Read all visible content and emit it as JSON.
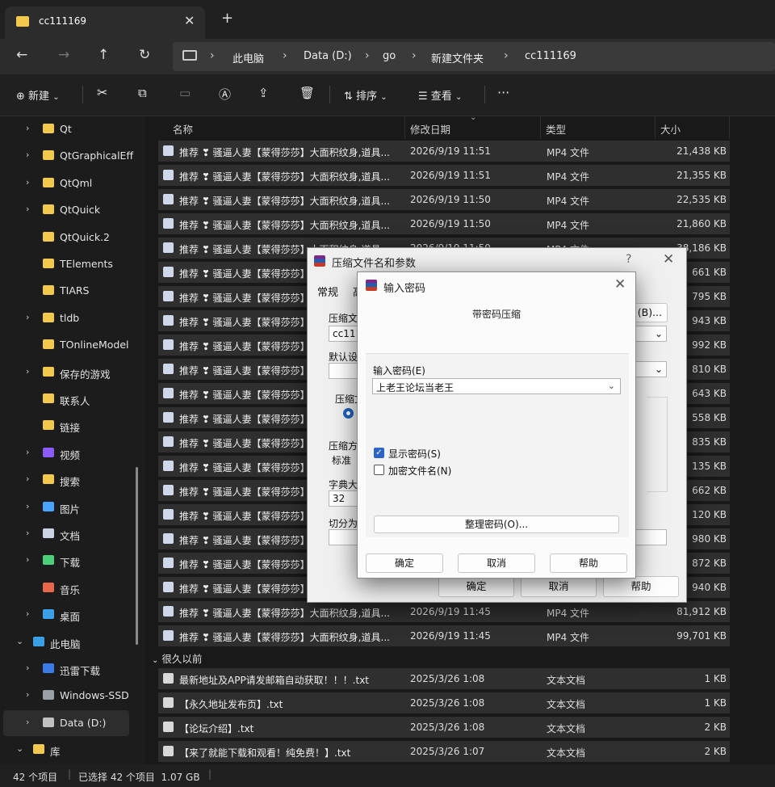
{
  "tab": {
    "title": "cc111169"
  },
  "address": {
    "crumbs": [
      "此电脑",
      "Data (D:)",
      "go",
      "新建文件夹",
      "cc111169"
    ]
  },
  "toolbar": {
    "new_label": "新建",
    "sort_label": "排序",
    "view_label": "查看",
    "more_label": "···"
  },
  "sidebar": {
    "items": [
      {
        "label": "Qt",
        "chev": true
      },
      {
        "label": "QtGraphicalEff",
        "chev": true
      },
      {
        "label": "QtQml",
        "chev": true
      },
      {
        "label": "QtQuick",
        "chev": true
      },
      {
        "label": "QtQuick.2",
        "chev": false
      },
      {
        "label": "TElements",
        "chev": false
      },
      {
        "label": "TIARS",
        "chev": false
      },
      {
        "label": "tldb",
        "chev": true
      },
      {
        "label": "TOnlineModel",
        "chev": false
      },
      {
        "label": "保存的游戏",
        "chev": true
      },
      {
        "label": "联系人",
        "chev": false
      },
      {
        "label": "链接",
        "chev": false
      },
      {
        "label": "视频",
        "chev": true
      },
      {
        "label": "搜索",
        "chev": true
      },
      {
        "label": "图片",
        "chev": true
      },
      {
        "label": "文档",
        "chev": true
      },
      {
        "label": "下载",
        "chev": true
      },
      {
        "label": "音乐",
        "chev": false
      },
      {
        "label": "桌面",
        "chev": true
      },
      {
        "label": "此电脑",
        "chev": true
      },
      {
        "label": "迅雷下载",
        "chev": true
      },
      {
        "label": "Windows-SSD",
        "chev": true
      },
      {
        "label": "Data (D:)",
        "chev": true
      },
      {
        "label": "库",
        "chev": true
      }
    ]
  },
  "columns": {
    "name": "名称",
    "date": "修改日期",
    "type": "类型",
    "size": "大小"
  },
  "files": [
    {
      "name": "推荐 ❣ 骚逼人妻【蒙得莎莎】大面积纹身,道具...",
      "date": "2026/9/19 11:51",
      "type": "MP4 文件",
      "size": "21,438 KB"
    },
    {
      "name": "推荐 ❣ 骚逼人妻【蒙得莎莎】大面积纹身,道具...",
      "date": "2026/9/19 11:51",
      "type": "MP4 文件",
      "size": "21,355 KB"
    },
    {
      "name": "推荐 ❣ 骚逼人妻【蒙得莎莎】大面积纹身,道具...",
      "date": "2026/9/19 11:50",
      "type": "MP4 文件",
      "size": "22,535 KB"
    },
    {
      "name": "推荐 ❣ 骚逼人妻【蒙得莎莎】大面积纹身,道具...",
      "date": "2026/9/19 11:50",
      "type": "MP4 文件",
      "size": "21,860 KB"
    },
    {
      "name": "推荐 ❣ 骚逼人妻【蒙得莎莎】大面积纹身,道具...",
      "date": "2026/9/19 11:50",
      "type": "MP4 文件",
      "size": "38,186 KB"
    },
    {
      "name": "推荐 ❣ 骚逼人妻【蒙得莎莎】大面积纹身,道具...",
      "date": "",
      "type": "",
      "size": "661 KB"
    },
    {
      "name": "推荐 ❣ 骚逼人妻【蒙得莎莎】大面积纹身,道具...",
      "date": "",
      "type": "",
      "size": "795 KB"
    },
    {
      "name": "推荐 ❣ 骚逼人妻【蒙得莎莎】大面积纹身,道具...",
      "date": "",
      "type": "",
      "size": "943 KB"
    },
    {
      "name": "推荐 ❣ 骚逼人妻【蒙得莎莎】大面积纹身,道具...",
      "date": "",
      "type": "",
      "size": "992 KB"
    },
    {
      "name": "推荐 ❣ 骚逼人妻【蒙得莎莎】大面积纹身,道具...",
      "date": "",
      "type": "",
      "size": "810 KB"
    },
    {
      "name": "推荐 ❣ 骚逼人妻【蒙得莎莎】大面积纹身,道具...",
      "date": "",
      "type": "",
      "size": "643 KB"
    },
    {
      "name": "推荐 ❣ 骚逼人妻【蒙得莎莎】大面积纹身,道具...",
      "date": "",
      "type": "",
      "size": "558 KB"
    },
    {
      "name": "推荐 ❣ 骚逼人妻【蒙得莎莎】大面积纹身,道具...",
      "date": "",
      "type": "",
      "size": "835 KB"
    },
    {
      "name": "推荐 ❣ 骚逼人妻【蒙得莎莎】大面积纹身,道具...",
      "date": "",
      "type": "",
      "size": "135 KB"
    },
    {
      "name": "推荐 ❣ 骚逼人妻【蒙得莎莎】大面积纹身,道具...",
      "date": "",
      "type": "",
      "size": "662 KB"
    },
    {
      "name": "推荐 ❣ 骚逼人妻【蒙得莎莎】大面积纹身,道具...",
      "date": "",
      "type": "",
      "size": "120 KB"
    },
    {
      "name": "推荐 ❣ 骚逼人妻【蒙得莎莎】大面积纹身,道具...",
      "date": "",
      "type": "",
      "size": "980 KB"
    },
    {
      "name": "推荐 ❣ 骚逼人妻【蒙得莎莎】大面积纹身,道具...",
      "date": "",
      "type": "",
      "size": "872 KB"
    },
    {
      "name": "推荐 ❣ 骚逼人妻【蒙得莎莎】大面积纹身,道具...",
      "date": "",
      "type": "",
      "size": "940 KB"
    },
    {
      "name": "推荐 ❣ 骚逼人妻【蒙得莎莎】大面积纹身,道具...",
      "date": "2026/9/19 11:45",
      "type": "MP4 文件",
      "size": "81,912 KB"
    },
    {
      "name": "推荐 ❣ 骚逼人妻【蒙得莎莎】大面积纹身,道具...",
      "date": "2026/9/19 11:45",
      "type": "MP4 文件",
      "size": "99,701 KB"
    }
  ],
  "group_label": "很久以前",
  "old_files": [
    {
      "name": "最新地址及APP请发邮箱自动获取！！！.txt",
      "date": "2025/3/26 1:08",
      "type": "文本文档",
      "size": "1 KB"
    },
    {
      "name": "【永久地址发布页】.txt",
      "date": "2025/3/26 1:08",
      "type": "文本文档",
      "size": "1 KB"
    },
    {
      "name": "【论坛介绍】.txt",
      "date": "2025/3/26 1:08",
      "type": "文本文档",
      "size": "2 KB"
    },
    {
      "name": "【来了就能下载和观看！纯免费！】.txt",
      "date": "2025/3/26 1:07",
      "type": "文本文档",
      "size": "2 KB"
    }
  ],
  "status": {
    "count": "42 个项目",
    "selected": "已选择 42 个项目  1.07 GB"
  },
  "archive_dialog": {
    "title": "压缩文件名和参数",
    "help_q": "?",
    "tab_general": "常规",
    "tab_second": "高",
    "archive_name_label": "压缩文件",
    "archive_name_value": "cc1111",
    "browse_label": "(B)...",
    "profile_label": "默认设",
    "format_label": "压缩文",
    "method_label": "压缩方",
    "method_value": "标准",
    "dict_label": "字典大小",
    "dict_value": "32",
    "split_label": "切分为分",
    "ok_label": "确定",
    "cancel_label": "取消",
    "help_label": "帮助",
    "sizes_right": []
  },
  "password_dialog": {
    "title": "输入密码",
    "subtitle": "带密码压缩",
    "input_label": "输入密码(E)",
    "password_value": "上老王论坛当老王",
    "show_password_label": "显示密码(S)",
    "show_password_checked": true,
    "encrypt_names_label": "加密文件名(N)",
    "encrypt_names_checked": false,
    "organize_label": "整理密码(O)...",
    "ok_label": "确定",
    "cancel_label": "取消",
    "help_label": "帮助"
  }
}
